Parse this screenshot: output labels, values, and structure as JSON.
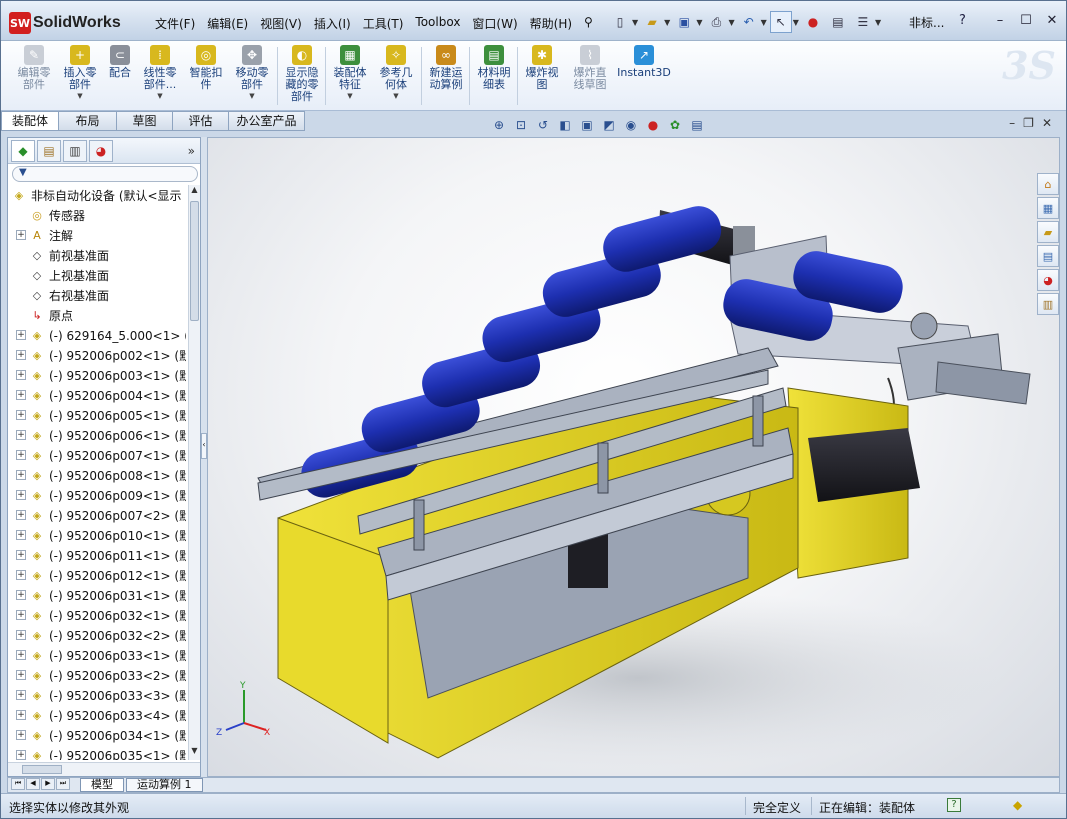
{
  "app": {
    "name": "SolidWorks",
    "logo_text": "SW",
    "window_title": "非标...",
    "help": "?"
  },
  "menu": [
    "文件(F)",
    "编辑(E)",
    "视图(V)",
    "插入(I)",
    "工具(T)",
    "Toolbox",
    "窗口(W)",
    "帮助(H)"
  ],
  "ribbon": [
    {
      "label": "编辑零\n部件",
      "disabled": true
    },
    {
      "label": "插入零\n部件",
      "arrow": true
    },
    {
      "label": "配合"
    },
    {
      "label": "线性零\n部件...",
      "arrow": true
    },
    {
      "label": "智能扣\n件"
    },
    {
      "label": "移动零\n部件",
      "arrow": true
    },
    {
      "label": "显示隐\n藏的零\n部件"
    },
    {
      "label": "装配体\n特征",
      "arrow": true
    },
    {
      "label": "参考几\n何体",
      "arrow": true
    },
    {
      "label": "新建运\n动算例"
    },
    {
      "label": "材料明\n细表"
    },
    {
      "label": "爆炸视\n图"
    },
    {
      "label": "爆炸直\n线草图",
      "disabled": true
    },
    {
      "label": "Instant3D"
    }
  ],
  "tabs": [
    "装配体",
    "布局",
    "草图",
    "评估",
    "办公室产品"
  ],
  "tree": {
    "root": "非标自动化设备 (默认<显示",
    "items": [
      {
        "label": "传感器",
        "icon": "sensor-icon",
        "expand": false
      },
      {
        "label": "注解",
        "icon": "annotation-icon",
        "expand": true
      },
      {
        "label": "前视基准面",
        "icon": "plane-icon",
        "expand": false
      },
      {
        "label": "上视基准面",
        "icon": "plane-icon",
        "expand": false
      },
      {
        "label": "右视基准面",
        "icon": "plane-icon",
        "expand": false
      },
      {
        "label": "原点",
        "icon": "origin-icon",
        "expand": false
      },
      {
        "label": "(-) 629164_5.000<1> (默",
        "icon": "part-icon",
        "expand": true
      },
      {
        "label": "(-) 952006p002<1> (默",
        "icon": "part-icon",
        "expand": true
      },
      {
        "label": "(-) 952006p003<1> (默",
        "icon": "part-icon",
        "expand": true
      },
      {
        "label": "(-) 952006p004<1> (默",
        "icon": "part-icon",
        "expand": true
      },
      {
        "label": "(-) 952006p005<1> (默",
        "icon": "part-icon",
        "expand": true
      },
      {
        "label": "(-) 952006p006<1> (默",
        "icon": "part-icon",
        "expand": true
      },
      {
        "label": "(-) 952006p007<1> (默",
        "icon": "part-icon",
        "expand": true
      },
      {
        "label": "(-) 952006p008<1> (默",
        "icon": "part-icon",
        "expand": true
      },
      {
        "label": "(-) 952006p009<1> (默",
        "icon": "part-icon",
        "expand": true
      },
      {
        "label": "(-) 952006p007<2> (默",
        "icon": "part-icon",
        "expand": true
      },
      {
        "label": "(-) 952006p010<1> (默",
        "icon": "part-icon",
        "expand": true
      },
      {
        "label": "(-) 952006p011<1> (默",
        "icon": "part-icon",
        "expand": true
      },
      {
        "label": "(-) 952006p012<1> (默",
        "icon": "part-icon",
        "expand": true
      },
      {
        "label": "(-) 952006p031<1> (默",
        "icon": "part-icon",
        "expand": true
      },
      {
        "label": "(-) 952006p032<1> (默",
        "icon": "part-icon",
        "expand": true
      },
      {
        "label": "(-) 952006p032<2> (默",
        "icon": "part-icon",
        "expand": true
      },
      {
        "label": "(-) 952006p033<1> (默",
        "icon": "part-icon",
        "expand": true
      },
      {
        "label": "(-) 952006p033<2> (默",
        "icon": "part-icon",
        "expand": true
      },
      {
        "label": "(-) 952006p033<3> (默",
        "icon": "part-icon",
        "expand": true
      },
      {
        "label": "(-) 952006p033<4> (默",
        "icon": "part-icon",
        "expand": true
      },
      {
        "label": "(-) 952006p034<1> (默",
        "icon": "part-icon",
        "expand": true
      },
      {
        "label": "(-) 952006p035<1> (默",
        "icon": "part-icon",
        "expand": true
      }
    ]
  },
  "model_tabs": [
    "模型",
    "运动算例 1"
  ],
  "status": {
    "message": "选择实体以修改其外观",
    "definition": "完全定义",
    "editing": "正在编辑：装配体"
  },
  "colors": {
    "frame_yellow": "#e2d21f",
    "roller_blue": "#1d2fb0",
    "metal_gray": "#9aa3b3",
    "motor_black": "#1e1e24"
  }
}
